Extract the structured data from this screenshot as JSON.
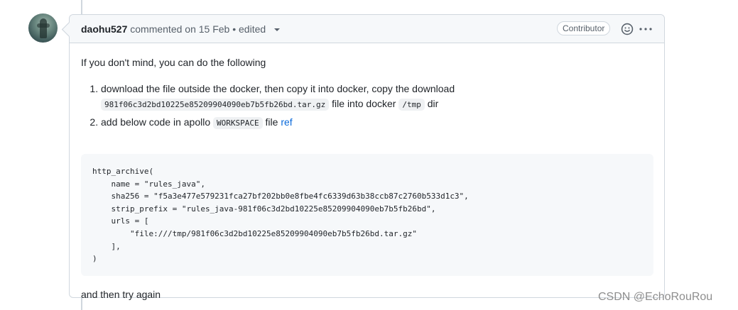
{
  "comment": {
    "author": "daohu527",
    "meta": "commented on 15 Feb • edited",
    "badge": "Contributor",
    "body": {
      "intro": "If you don't mind, you can do the following",
      "steps": [
        {
          "text_before": "download the file outside the docker, then copy it into docker, copy the download",
          "code_file": "981f06c3d2bd10225e85209904090eb7b5fb26bd.tar.gz",
          "text_mid": "file into docker",
          "code_dir": "/tmp",
          "text_after": "dir"
        },
        {
          "text_before": "add below code in apollo",
          "code_workspace": "WORKSPACE",
          "text_mid": "file",
          "link": "ref"
        }
      ],
      "code_block": "http_archive(\n    name = \"rules_java\",\n    sha256 = \"f5a3e477e579231fca27bf202bb0e8fbe4fc6339d63b38ccb87c2760b533d1c3\",\n    strip_prefix = \"rules_java-981f06c3d2bd10225e85209904090eb7b5fb26bd\",\n    urls = [\n        \"file:///tmp/981f06c3d2bd10225e85209904090eb7b5fb26bd.tar.gz\"\n    ],\n)",
      "outro": "and then try again"
    }
  },
  "icons": {
    "emoji": "smiley-icon",
    "more": "kebab-horizontal-icon",
    "edit_caret": "triangle-down-icon"
  },
  "watermark": "CSDN @EchoRouRou"
}
